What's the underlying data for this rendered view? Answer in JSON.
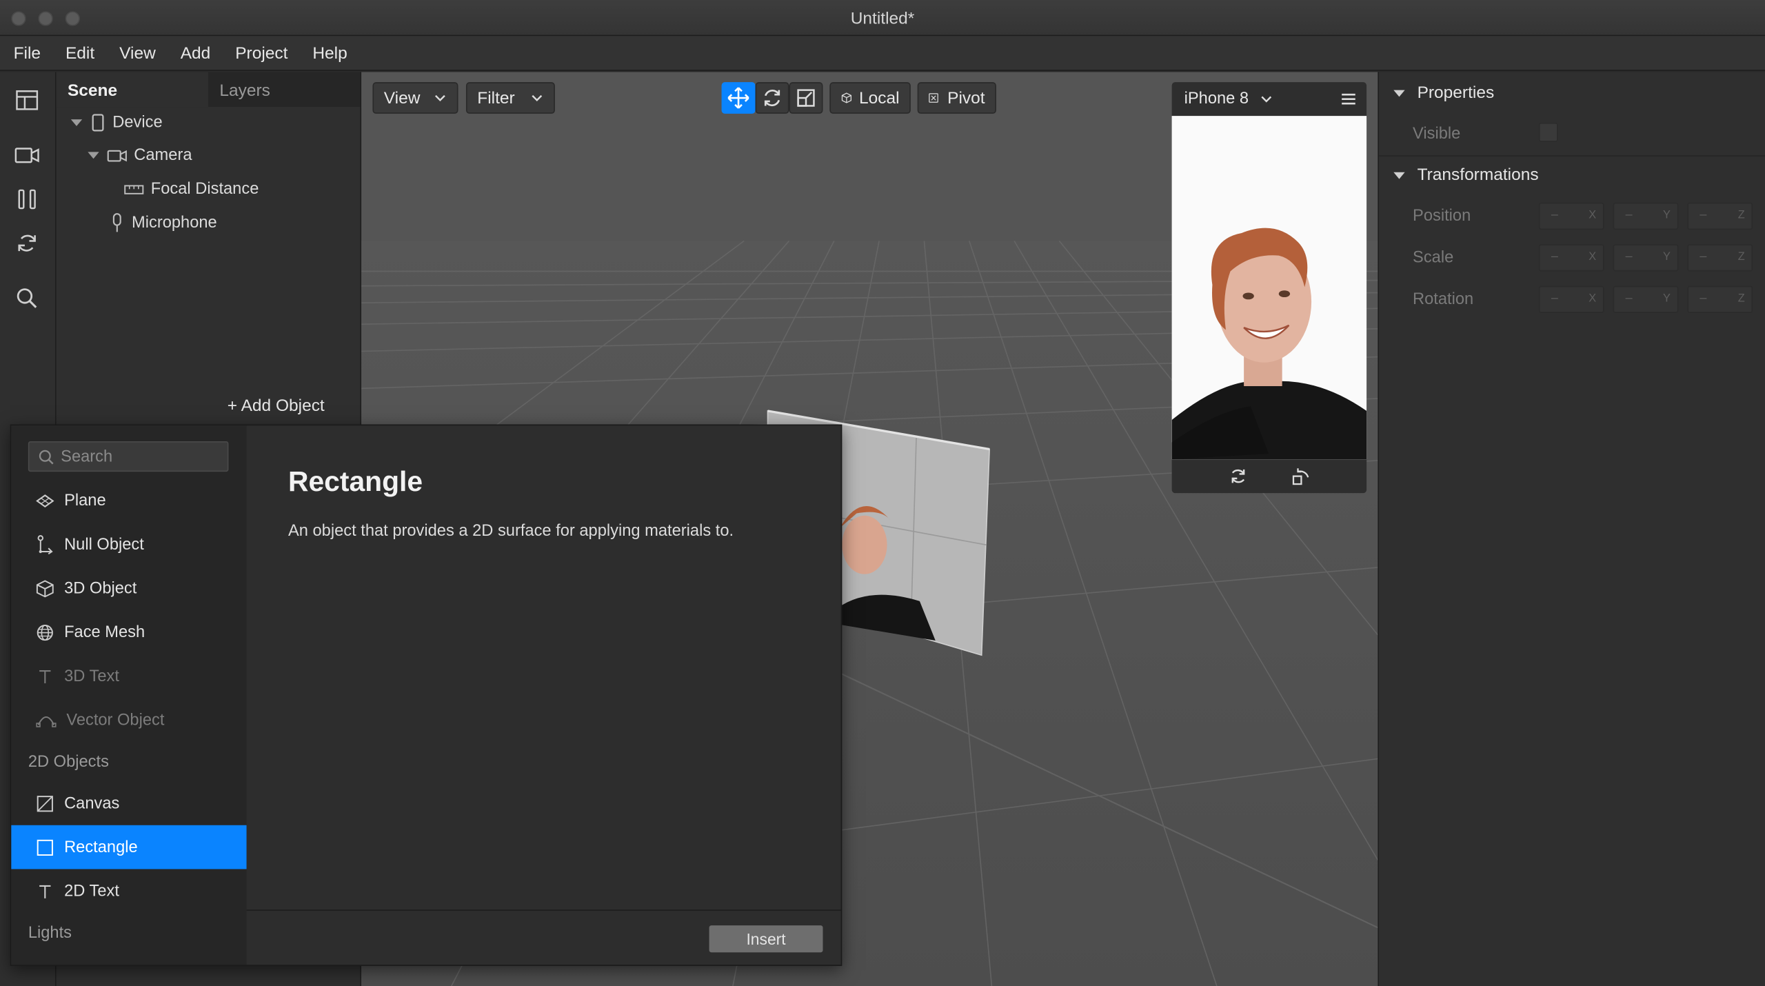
{
  "window": {
    "title": "Untitled*"
  },
  "menu": [
    "File",
    "Edit",
    "View",
    "Add",
    "Project",
    "Help"
  ],
  "scene_panel": {
    "tabs": [
      "Scene",
      "Layers"
    ],
    "tree": [
      "Device",
      "Camera",
      "Focal Distance",
      "Microphone"
    ],
    "add_object": "Add Object"
  },
  "viewport": {
    "view_label": "View",
    "filter_label": "Filter",
    "local_label": "Local",
    "pivot_label": "Pivot"
  },
  "preview": {
    "device": "iPhone 8"
  },
  "properties": {
    "section_properties": "Properties",
    "visible_label": "Visible",
    "section_transformations": "Transformations",
    "rows": [
      "Position",
      "Scale",
      "Rotation"
    ],
    "dash": "–",
    "axes": [
      "X",
      "Y",
      "Z"
    ]
  },
  "popup": {
    "search_placeholder": "Search",
    "items": [
      "Plane",
      "Null Object",
      "3D Object",
      "Face Mesh",
      "3D Text",
      "Vector Object"
    ],
    "category_2d": "2D Objects",
    "items_2d": [
      "Canvas",
      "Rectangle",
      "2D Text"
    ],
    "category_lights": "Lights",
    "title": "Rectangle",
    "description": "An object that provides a 2D surface for applying materials to.",
    "insert_label": "Insert"
  },
  "colors": {
    "accent": "#0a84ff"
  }
}
